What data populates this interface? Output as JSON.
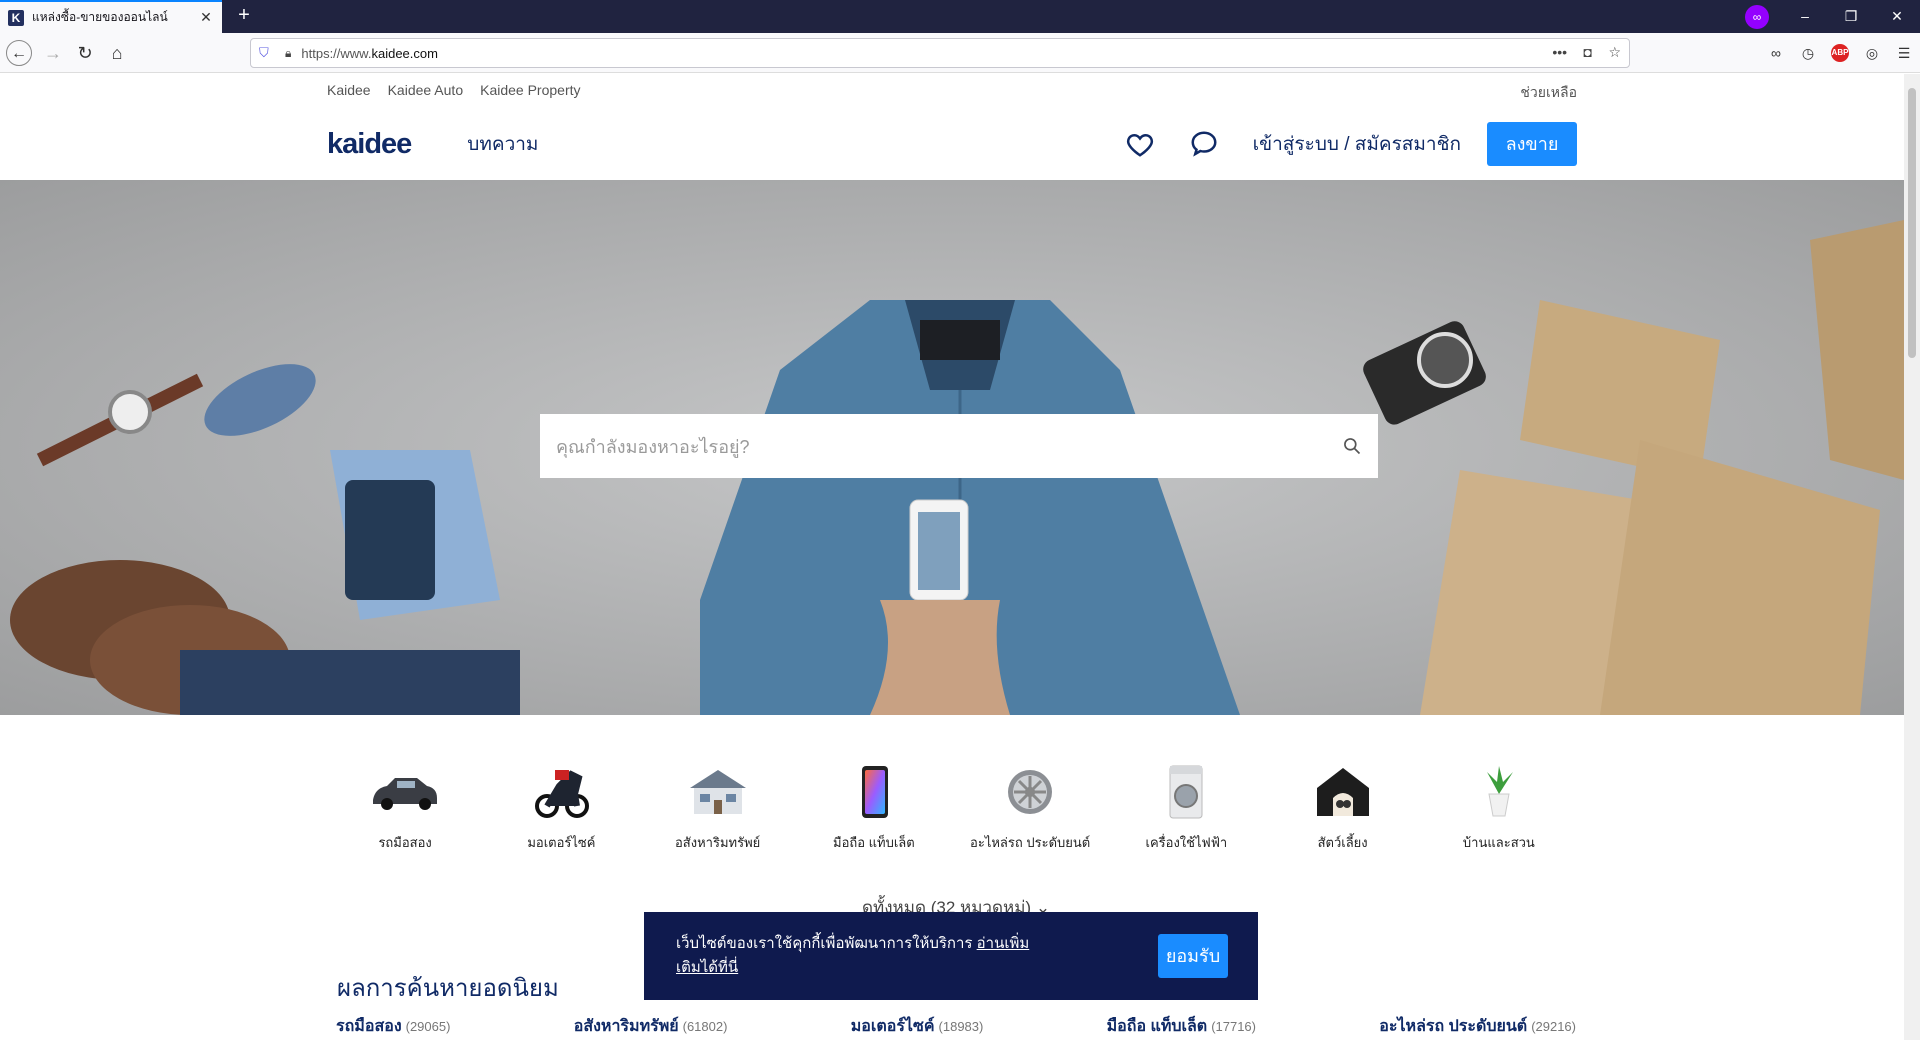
{
  "browser": {
    "tab_title": "แหล่งซื้อ-ขายของออนไลน์",
    "favicon_letter": "K",
    "url_prefix": "https://www.",
    "url_domain": "kaidee.com"
  },
  "site": {
    "top_links": [
      "Kaidee",
      "Kaidee Auto",
      "Kaidee Property"
    ],
    "help": "ช่วยเหลือ",
    "logo": "kaidee",
    "articles": "บทความ",
    "login": "เข้าสู่ระบบ / สมัครสมาชิก",
    "sell": "ลงขาย"
  },
  "search": {
    "placeholder": "คุณกำลังมองหาอะไรอยู่?"
  },
  "categories": [
    {
      "label": "รถมือสอง",
      "icon": "car-icon"
    },
    {
      "label": "มอเตอร์ไซค์",
      "icon": "motorcycle-icon"
    },
    {
      "label": "อสังหาริมทรัพย์",
      "icon": "house-icon"
    },
    {
      "label": "มือถือ แท็บเล็ต",
      "icon": "phone-icon"
    },
    {
      "label": "อะไหล่รถ ประดับยนต์",
      "icon": "wheel-icon"
    },
    {
      "label": "เครื่องใช้ไฟฟ้า",
      "icon": "washer-icon"
    },
    {
      "label": "สัตว์เลี้ยง",
      "icon": "pet-house-icon"
    },
    {
      "label": "บ้านและสวน",
      "icon": "plant-icon"
    }
  ],
  "see_all": "ดูทั้งหมด (32 หมวดหมู่)",
  "popular_title": "ผลการค้นหายอดนิยม",
  "popular": [
    {
      "label": "รถมือสอง",
      "count": "(29065)"
    },
    {
      "label": "อสังหาริมทรัพย์",
      "count": "(61802)"
    },
    {
      "label": "มอเตอร์ไซค์",
      "count": "(18983)"
    },
    {
      "label": "มือถือ แท็บเล็ต",
      "count": "(17716)"
    },
    {
      "label": "อะไหล่รถ ประดับยนต์",
      "count": "(29216)"
    }
  ],
  "cookie": {
    "text": "เว็บไซต์ของเราใช้คุกกี้เพื่อพัฒนาการให้บริการ",
    "link": "อ่านเพิ่มเติมได้ที่นี่",
    "accept": "ยอมรับ"
  },
  "colors": {
    "brand": "#102a66",
    "accent": "#1a8cff",
    "cookie_bg": "#0f1a4e"
  }
}
